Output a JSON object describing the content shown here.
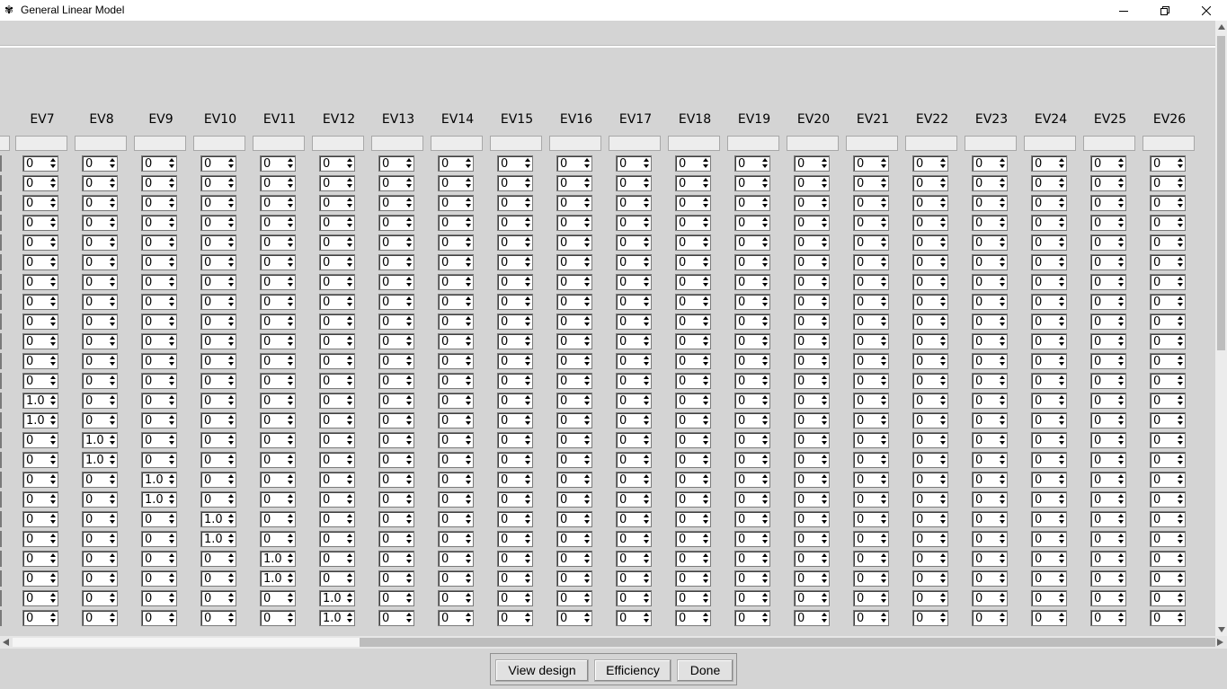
{
  "window": {
    "title": "General Linear Model",
    "app_icon": "✾"
  },
  "table": {
    "columns": [
      {
        "header": "EV7",
        "values": [
          "0",
          "0",
          "0",
          "0",
          "0",
          "0",
          "0",
          "0",
          "0",
          "0",
          "0",
          "0",
          "1.0",
          "1.0",
          "0",
          "0",
          "0",
          "0",
          "0",
          "0",
          "0",
          "0",
          "0",
          "0"
        ]
      },
      {
        "header": "EV8",
        "values": [
          "0",
          "0",
          "0",
          "0",
          "0",
          "0",
          "0",
          "0",
          "0",
          "0",
          "0",
          "0",
          "0",
          "0",
          "1.0",
          "1.0",
          "0",
          "0",
          "0",
          "0",
          "0",
          "0",
          "0",
          "0"
        ]
      },
      {
        "header": "EV9",
        "values": [
          "0",
          "0",
          "0",
          "0",
          "0",
          "0",
          "0",
          "0",
          "0",
          "0",
          "0",
          "0",
          "0",
          "0",
          "0",
          "0",
          "1.0",
          "1.0",
          "0",
          "0",
          "0",
          "0",
          "0",
          "0"
        ]
      },
      {
        "header": "EV10",
        "values": [
          "0",
          "0",
          "0",
          "0",
          "0",
          "0",
          "0",
          "0",
          "0",
          "0",
          "0",
          "0",
          "0",
          "0",
          "0",
          "0",
          "0",
          "0",
          "1.0",
          "1.0",
          "0",
          "0",
          "0",
          "0"
        ]
      },
      {
        "header": "EV11",
        "values": [
          "0",
          "0",
          "0",
          "0",
          "0",
          "0",
          "0",
          "0",
          "0",
          "0",
          "0",
          "0",
          "0",
          "0",
          "0",
          "0",
          "0",
          "0",
          "0",
          "0",
          "1.0",
          "1.0",
          "0",
          "0"
        ]
      },
      {
        "header": "EV12",
        "values": [
          "0",
          "0",
          "0",
          "0",
          "0",
          "0",
          "0",
          "0",
          "0",
          "0",
          "0",
          "0",
          "0",
          "0",
          "0",
          "0",
          "0",
          "0",
          "0",
          "0",
          "0",
          "0",
          "1.0",
          "1.0"
        ]
      },
      {
        "header": "EV13",
        "values": [
          "0",
          "0",
          "0",
          "0",
          "0",
          "0",
          "0",
          "0",
          "0",
          "0",
          "0",
          "0",
          "0",
          "0",
          "0",
          "0",
          "0",
          "0",
          "0",
          "0",
          "0",
          "0",
          "0",
          "0"
        ]
      },
      {
        "header": "EV14",
        "values": [
          "0",
          "0",
          "0",
          "0",
          "0",
          "0",
          "0",
          "0",
          "0",
          "0",
          "0",
          "0",
          "0",
          "0",
          "0",
          "0",
          "0",
          "0",
          "0",
          "0",
          "0",
          "0",
          "0",
          "0"
        ]
      },
      {
        "header": "EV15",
        "values": [
          "0",
          "0",
          "0",
          "0",
          "0",
          "0",
          "0",
          "0",
          "0",
          "0",
          "0",
          "0",
          "0",
          "0",
          "0",
          "0",
          "0",
          "0",
          "0",
          "0",
          "0",
          "0",
          "0",
          "0"
        ]
      },
      {
        "header": "EV16",
        "values": [
          "0",
          "0",
          "0",
          "0",
          "0",
          "0",
          "0",
          "0",
          "0",
          "0",
          "0",
          "0",
          "0",
          "0",
          "0",
          "0",
          "0",
          "0",
          "0",
          "0",
          "0",
          "0",
          "0",
          "0"
        ]
      },
      {
        "header": "EV17",
        "values": [
          "0",
          "0",
          "0",
          "0",
          "0",
          "0",
          "0",
          "0",
          "0",
          "0",
          "0",
          "0",
          "0",
          "0",
          "0",
          "0",
          "0",
          "0",
          "0",
          "0",
          "0",
          "0",
          "0",
          "0"
        ]
      },
      {
        "header": "EV18",
        "values": [
          "0",
          "0",
          "0",
          "0",
          "0",
          "0",
          "0",
          "0",
          "0",
          "0",
          "0",
          "0",
          "0",
          "0",
          "0",
          "0",
          "0",
          "0",
          "0",
          "0",
          "0",
          "0",
          "0",
          "0"
        ]
      },
      {
        "header": "EV19",
        "values": [
          "0",
          "0",
          "0",
          "0",
          "0",
          "0",
          "0",
          "0",
          "0",
          "0",
          "0",
          "0",
          "0",
          "0",
          "0",
          "0",
          "0",
          "0",
          "0",
          "0",
          "0",
          "0",
          "0",
          "0"
        ]
      },
      {
        "header": "EV20",
        "values": [
          "0",
          "0",
          "0",
          "0",
          "0",
          "0",
          "0",
          "0",
          "0",
          "0",
          "0",
          "0",
          "0",
          "0",
          "0",
          "0",
          "0",
          "0",
          "0",
          "0",
          "0",
          "0",
          "0",
          "0"
        ]
      },
      {
        "header": "EV21",
        "values": [
          "0",
          "0",
          "0",
          "0",
          "0",
          "0",
          "0",
          "0",
          "0",
          "0",
          "0",
          "0",
          "0",
          "0",
          "0",
          "0",
          "0",
          "0",
          "0",
          "0",
          "0",
          "0",
          "0",
          "0"
        ]
      },
      {
        "header": "EV22",
        "values": [
          "0",
          "0",
          "0",
          "0",
          "0",
          "0",
          "0",
          "0",
          "0",
          "0",
          "0",
          "0",
          "0",
          "0",
          "0",
          "0",
          "0",
          "0",
          "0",
          "0",
          "0",
          "0",
          "0",
          "0"
        ]
      },
      {
        "header": "EV23",
        "values": [
          "0",
          "0",
          "0",
          "0",
          "0",
          "0",
          "0",
          "0",
          "0",
          "0",
          "0",
          "0",
          "0",
          "0",
          "0",
          "0",
          "0",
          "0",
          "0",
          "0",
          "0",
          "0",
          "0",
          "0"
        ]
      },
      {
        "header": "EV24",
        "values": [
          "0",
          "0",
          "0",
          "0",
          "0",
          "0",
          "0",
          "0",
          "0",
          "0",
          "0",
          "0",
          "0",
          "0",
          "0",
          "0",
          "0",
          "0",
          "0",
          "0",
          "0",
          "0",
          "0",
          "0"
        ]
      },
      {
        "header": "EV25",
        "values": [
          "0",
          "0",
          "0",
          "0",
          "0",
          "0",
          "0",
          "0",
          "0",
          "0",
          "0",
          "0",
          "0",
          "0",
          "0",
          "0",
          "0",
          "0",
          "0",
          "0",
          "0",
          "0",
          "0",
          "0"
        ]
      },
      {
        "header": "EV26",
        "values": [
          "0",
          "0",
          "0",
          "0",
          "0",
          "0",
          "0",
          "0",
          "0",
          "0",
          "0",
          "0",
          "0",
          "0",
          "0",
          "0",
          "0",
          "0",
          "0",
          "0",
          "0",
          "0",
          "0",
          "0"
        ]
      }
    ]
  },
  "buttons": {
    "view_design": "View design",
    "efficiency": "Efficiency",
    "done": "Done"
  }
}
